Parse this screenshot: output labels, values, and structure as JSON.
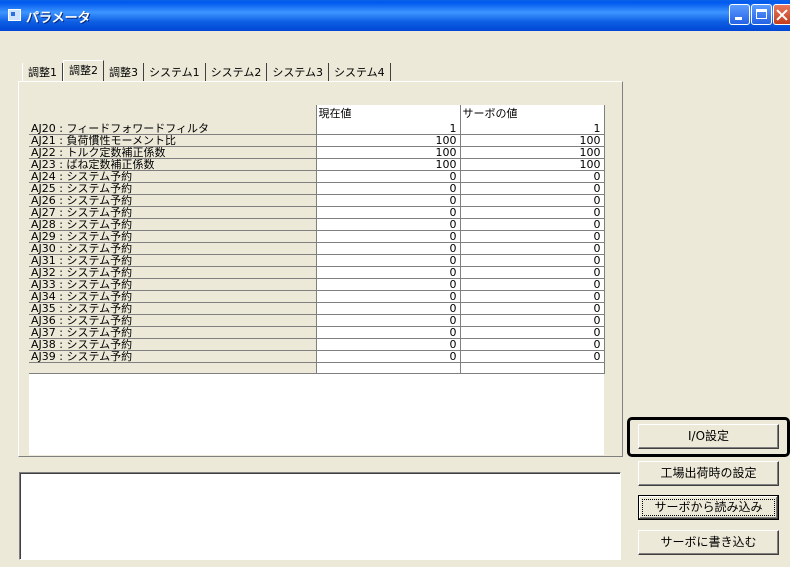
{
  "window": {
    "title": "パラメータ"
  },
  "tabs": [
    {
      "label": "調整1",
      "active": false
    },
    {
      "label": "調整2",
      "active": true
    },
    {
      "label": "調整3",
      "active": false
    },
    {
      "label": "システム1",
      "active": false
    },
    {
      "label": "システム2",
      "active": false
    },
    {
      "label": "システム3",
      "active": false
    },
    {
      "label": "システム4",
      "active": false
    }
  ],
  "table": {
    "headers": [
      "",
      "現在値",
      "サーボの値"
    ],
    "rows": [
      [
        "AJ20 : フィードフォワードフィルタ",
        "1",
        "1"
      ],
      [
        "AJ21 : 負荷慣性モーメント比",
        "100",
        "100"
      ],
      [
        "AJ22 : トルク定数補正係数",
        "100",
        "100"
      ],
      [
        "AJ23 : ばね定数補正係数",
        "100",
        "100"
      ],
      [
        "AJ24 : システム予約",
        "0",
        "0"
      ],
      [
        "AJ25 : システム予約",
        "0",
        "0"
      ],
      [
        "AJ26 : システム予約",
        "0",
        "0"
      ],
      [
        "AJ27 : システム予約",
        "0",
        "0"
      ],
      [
        "AJ28 : システム予約",
        "0",
        "0"
      ],
      [
        "AJ29 : システム予約",
        "0",
        "0"
      ],
      [
        "AJ30 : システム予約",
        "0",
        "0"
      ],
      [
        "AJ31 : システム予約",
        "0",
        "0"
      ],
      [
        "AJ32 : システム予約",
        "0",
        "0"
      ],
      [
        "AJ33 : システム予約",
        "0",
        "0"
      ],
      [
        "AJ34 : システム予約",
        "0",
        "0"
      ],
      [
        "AJ35 : システム予約",
        "0",
        "0"
      ],
      [
        "AJ36 : システム予約",
        "0",
        "0"
      ],
      [
        "AJ37 : システム予約",
        "0",
        "0"
      ],
      [
        "AJ38 : システム予約",
        "0",
        "0"
      ],
      [
        "AJ39 : システム予約",
        "0",
        "0"
      ]
    ]
  },
  "buttons": {
    "io_settings": "I/O設定",
    "factory_settings": "工場出荷時の設定",
    "read_from_servo": "サーボから読み込み",
    "write_to_servo": "サーボに書き込む"
  },
  "icons": {
    "app": "app-window-icon",
    "minimize": "minimize-icon",
    "maximize": "maximize-icon",
    "close": "close-icon"
  }
}
